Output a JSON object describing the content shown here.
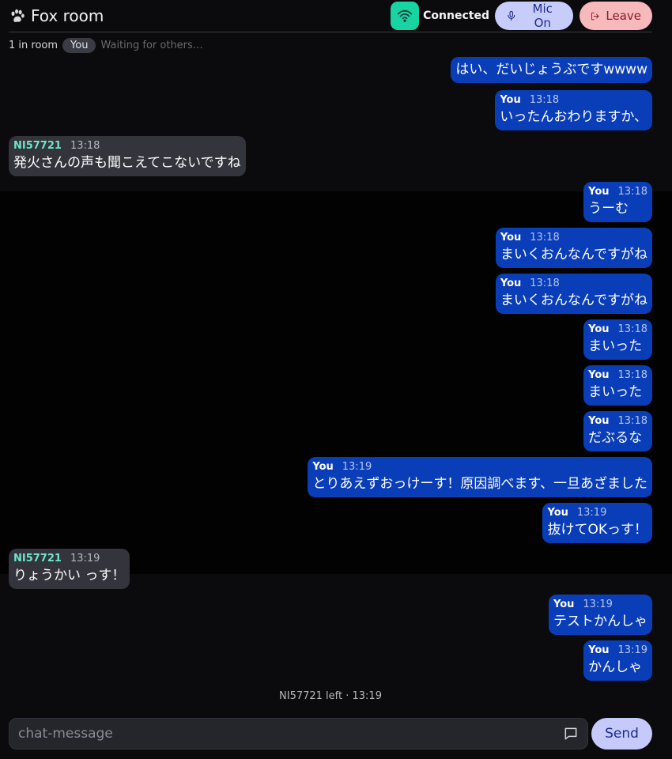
{
  "header": {
    "title": "Fox room",
    "logo_icon": "paw-icon",
    "status": "Connected",
    "status_icon": "wifi-icon",
    "mic_label": "Mic On",
    "leave_label": "Leave"
  },
  "room": {
    "count": "1 in room",
    "you_badge": "You",
    "waiting": "Waiting for others…"
  },
  "messages": [
    {
      "self": true,
      "sender": "",
      "time": "",
      "text": "はい、だいじょうぶですwwww"
    },
    {
      "self": true,
      "sender": "You",
      "time": "13:18",
      "text": "いったんおわりますか、"
    },
    {
      "self": false,
      "sender": "NI57721",
      "time": "13:18",
      "text": "発火さんの声も聞こえてこないですね"
    },
    {
      "self": true,
      "sender": "You",
      "time": "13:18",
      "text": "うーむ"
    },
    {
      "self": true,
      "sender": "You",
      "time": "13:18",
      "text": "まいくおんなんですがね"
    },
    {
      "self": true,
      "sender": "You",
      "time": "13:18",
      "text": "まいくおんなんですがね"
    },
    {
      "self": true,
      "sender": "You",
      "time": "13:18",
      "text": "まいった"
    },
    {
      "self": true,
      "sender": "You",
      "time": "13:18",
      "text": "まいった"
    },
    {
      "self": true,
      "sender": "You",
      "time": "13:18",
      "text": "だぶるな"
    },
    {
      "self": true,
      "sender": "You",
      "time": "13:19",
      "text": "とりあえずおっけーす！原因調べます、一旦あざました"
    },
    {
      "self": true,
      "sender": "You",
      "time": "13:19",
      "text": "抜けてOKっす！"
    },
    {
      "self": false,
      "sender": "NI57721",
      "time": "13:19",
      "text": "りょうかい っす！"
    },
    {
      "self": true,
      "sender": "You",
      "time": "13:19",
      "text": "テストかんしゃ"
    },
    {
      "self": true,
      "sender": "You",
      "time": "13:19",
      "text": "かんしゃ"
    }
  ],
  "system_message": "NI57721 left · 13:19",
  "composer": {
    "placeholder": "chat-message",
    "value": "",
    "send_label": "Send",
    "emoji_icon": "message-square-icon"
  },
  "colors": {
    "background": "#0b0b0d",
    "self_bubble": "#0a3db8",
    "other_bubble": "#33343c",
    "other_sender": "#6fe6c9",
    "status_chip": "#18d3a2",
    "mic_button": "#c7cdfb",
    "leave_button": "#f8b9bd",
    "send_button": "#c5cafb"
  }
}
